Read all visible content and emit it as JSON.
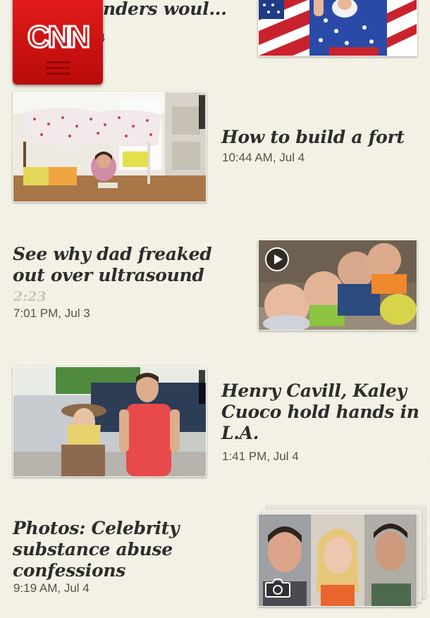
{
  "header": {
    "logo_text": "CNN"
  },
  "stories": [
    {
      "headline": "nders woul...",
      "timestamp": "4",
      "thumbnail": "uncle-sam-photo"
    },
    {
      "headline": "How to build a fort",
      "timestamp": "10:44 AM, Jul 4",
      "thumbnail": "children-fort-photo"
    },
    {
      "headline_lines": [
        "See why dad freaked",
        "out over ultrasound"
      ],
      "duration": "2:23",
      "timestamp": "7:01 PM, Jul 3",
      "thumbnail": "quadruplets-video",
      "badge_icon": "play-icon"
    },
    {
      "headline_lines": [
        "Henry Cavill, Kaley",
        "Cuoco hold hands in",
        "L.A."
      ],
      "timestamp": "1:41 PM, Jul 4",
      "thumbnail": "celebrity-couple-photo"
    },
    {
      "headline_lines": [
        "Photos: Celebrity",
        "substance abuse",
        "confessions"
      ],
      "timestamp": "9:19 AM, Jul 4",
      "thumbnail": "celebrity-mugshots-gallery",
      "badge_icon": "camera-icon"
    }
  ],
  "colors": {
    "background": "#f4f2e6",
    "headline": "#2d2d2d",
    "timestamp": "#55524a",
    "duration": "#c8c4b8",
    "logo_red": "#cc0000"
  }
}
